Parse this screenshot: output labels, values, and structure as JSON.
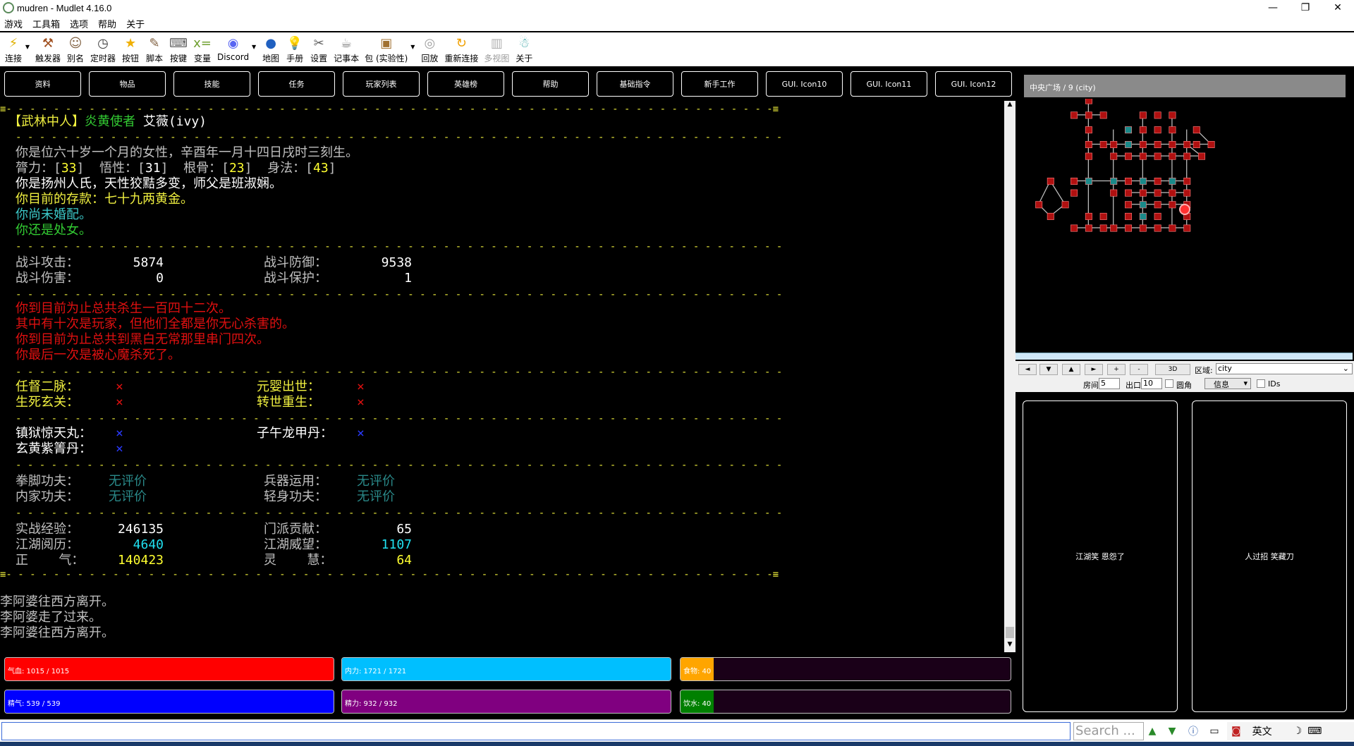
{
  "window": {
    "title": "mudren - Mudlet 4.16.0",
    "minimize": "—",
    "maximize": "❐",
    "close": "✕"
  },
  "menu": [
    "游戏",
    "工具箱",
    "选项",
    "帮助",
    "关于"
  ],
  "toolbar": [
    {
      "label": "连接",
      "icon": "connect-icon",
      "glyph": "⚡",
      "color": "#e0b000",
      "drop": true
    },
    {
      "label": "触发器",
      "icon": "trigger-icon",
      "glyph": "⚒",
      "color": "#a05020"
    },
    {
      "label": "别名",
      "icon": "alias-icon",
      "glyph": "☺",
      "color": "#806040"
    },
    {
      "label": "定时器",
      "icon": "timer-icon",
      "glyph": "◷",
      "color": "#404040"
    },
    {
      "label": "按钮",
      "icon": "star-icon",
      "glyph": "★",
      "color": "#f0b000"
    },
    {
      "label": "脚本",
      "icon": "script-icon",
      "glyph": "✎",
      "color": "#806040"
    },
    {
      "label": "按键",
      "icon": "keyboard-icon",
      "glyph": "⌨",
      "color": "#606060"
    },
    {
      "label": "变量",
      "icon": "variable-icon",
      "glyph": "x=",
      "color": "#70a030"
    },
    {
      "label": "Discord",
      "icon": "discord-icon",
      "glyph": "◉",
      "color": "#5865f2",
      "drop": true
    },
    {
      "label": "地图",
      "icon": "globe-icon",
      "glyph": "●",
      "color": "#2060c0"
    },
    {
      "label": "手册",
      "icon": "manual-icon",
      "glyph": "💡",
      "color": "#f0c000"
    },
    {
      "label": "设置",
      "icon": "settings-icon",
      "glyph": "✂",
      "color": "#606060"
    },
    {
      "label": "记事本",
      "icon": "notepad-icon",
      "glyph": "☕",
      "color": "#808080"
    },
    {
      "label": "包 (实验性)",
      "icon": "package-icon",
      "glyph": "▣",
      "color": "#a07030",
      "drop": true
    },
    {
      "label": "回放",
      "icon": "replay-icon",
      "glyph": "◎",
      "color": "#a0a0a0"
    },
    {
      "label": "重新连接",
      "icon": "reconnect-icon",
      "glyph": "↻",
      "color": "#f0a000"
    },
    {
      "label": "多视图",
      "icon": "multiview-icon",
      "glyph": "▥",
      "color": "#b0b0b0",
      "gray": true
    },
    {
      "label": "关于",
      "icon": "about-icon",
      "glyph": "☃",
      "color": "#30a0a0"
    }
  ],
  "gui_buttons": [
    "资料",
    "物品",
    "技能",
    "任务",
    "玩家列表",
    "英雄榜",
    "帮助",
    "基础指令",
    "新手工作",
    "GUI. Icon10",
    "GUI. Icon11",
    "GUI. Icon12"
  ],
  "console": {
    "header_name": [
      "【武林中人】",
      "炎黄使者",
      " 艾薇(ivy)"
    ],
    "bio": [
      "你是位六十岁一个月的女性，辛酉年一月十四日戌时三刻生。",
      "你是扬州人氏，天性狡黠多变，师父是班淑娴。",
      "你目前的存款：七十九两黄金。",
      "你尚未婚配。",
      "你还是处女。"
    ],
    "attrs": {
      "str_label": "膂力：[",
      "str": "33",
      "int_label": "]  悟性：[",
      "int": "31",
      "con_label": "]  根骨：[",
      "con": "23",
      "dex_label": "]  身法：[",
      "dex": "43",
      "end": "]"
    },
    "combat": {
      "atk_label": "战斗攻击：",
      "atk": "5874",
      "def_label": "战斗防御：",
      "def": "9538",
      "dmg_label": "战斗伤害：",
      "dmg": "0",
      "prot_label": "战斗保护：",
      "prot": "1"
    },
    "kills": [
      "你到目前为止总共杀生一百四十二次。",
      "其中有十次是玩家，但他们全都是你无心杀害的。",
      "你到目前为止总共到黑白无常那里串门四次。",
      "你最后一次是被心魔杀死了。"
    ],
    "quests": {
      "q1": "任督二脉：",
      "q2": "元婴出世：",
      "q3": "生死玄关：",
      "q4": "转世重生：",
      "x": "×"
    },
    "pills": {
      "p1": "镇狱惊天丸：",
      "p2": "子午龙甲丹：",
      "p3": "玄黄紫箐丹："
    },
    "skills": {
      "s1": "拳脚功夫：",
      "s2": "兵器运用：",
      "s3": "内家功夫：",
      "s4": "轻身功夫：",
      "none": "无评价"
    },
    "exp": {
      "e1": "实战经验：",
      "e1v": "246135",
      "e2": "门派贡献：",
      "e2v": "65",
      "e3": "江湖阅历：",
      "e3v": "4640",
      "e4": "江湖威望：",
      "e4v": "1107",
      "e5": "正    气：",
      "e5v": "140423",
      "e6": "灵    慧：",
      "e6v": "64"
    },
    "log": [
      "李阿婆往西方离开。",
      "李阿婆走了过来。",
      "李阿婆往西方离开。"
    ]
  },
  "gauges": [
    {
      "label": "气血: 1015 / 1015",
      "value": 1.0,
      "color": "#ff0000"
    },
    {
      "label": "内力: 1721 / 1721",
      "value": 1.0,
      "color": "#00bfff"
    },
    {
      "label": "食物: 40",
      "value": 0.1,
      "color": "#ffa500"
    },
    {
      "label": "精气: 539 / 539",
      "value": 1.0,
      "color": "#0000ff"
    },
    {
      "label": "精力: 932 / 932",
      "value": 1.0,
      "color": "#800080"
    },
    {
      "label": "饮水: 40",
      "value": 0.1,
      "color": "#008000"
    }
  ],
  "map": {
    "title": "中央广场 / 9 (city)",
    "buttons": [
      "◄",
      "▼",
      "▲",
      "►",
      "+",
      "-",
      "3D"
    ],
    "area_label": "区域:",
    "area_value": "city",
    "rooms_label": "房间",
    "rooms_value": "5",
    "exits_label": "出口",
    "exits_value": "10",
    "round_label": "圆角",
    "info_value": "信息",
    "ids_label": "IDs",
    "colors": {
      "room": "#b01010",
      "visited": "#1a8a8a",
      "player": "#ff3030",
      "line": "#c0c0c0"
    }
  },
  "sideboxes": [
    "江湖笑 恩怨了",
    "人过招 笑藏刀"
  ],
  "cmd": {
    "search_placeholder": "Search ...",
    "ime": "英文"
  }
}
